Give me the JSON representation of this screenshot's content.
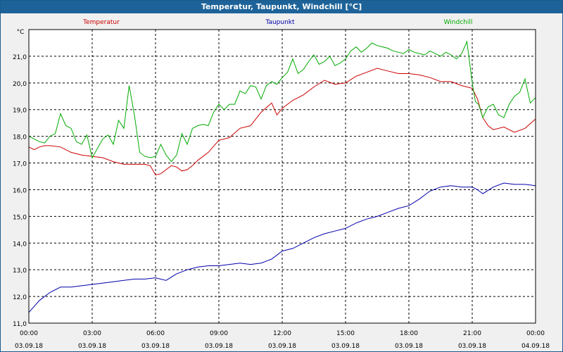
{
  "window": {
    "title": "Temperatur, Taupunkt, Windchill [°C]"
  },
  "chart_data": {
    "type": "line",
    "title": "Temperatur, Taupunkt, Windchill [°C]",
    "ylabel": "°C",
    "ylim": [
      11.0,
      22.0
    ],
    "yticks": [
      "11,0",
      "12,0",
      "13,0",
      "14,0",
      "15,0",
      "16,0",
      "17,0",
      "18,0",
      "19,0",
      "20,0",
      "21,0"
    ],
    "xlim": [
      0,
      24
    ],
    "xticks": [
      {
        "time": "00:00",
        "date": "03.09.18"
      },
      {
        "time": "03:00",
        "date": "03.09.18"
      },
      {
        "time": "06:00",
        "date": "03.09.18"
      },
      {
        "time": "09:00",
        "date": "03.09.18"
      },
      {
        "time": "12:00",
        "date": "03.09.18"
      },
      {
        "time": "15:00",
        "date": "03.09.18"
      },
      {
        "time": "18:00",
        "date": "03.09.18"
      },
      {
        "time": "21:00",
        "date": "03.09.18"
      },
      {
        "time": "00:00",
        "date": "04.09.18"
      }
    ],
    "grid": true,
    "series": [
      {
        "name": "Temperatur",
        "color": "#cc0000",
        "x": [
          0,
          0.25,
          0.5,
          0.75,
          1,
          1.5,
          2,
          2.5,
          3,
          3.5,
          4,
          4.5,
          5,
          5.5,
          5.75,
          6,
          6.25,
          6.5,
          6.75,
          7,
          7.25,
          7.5,
          7.75,
          8,
          8.5,
          9,
          9.5,
          10,
          10.5,
          11,
          11.5,
          11.75,
          12,
          12.5,
          13,
          13.5,
          14,
          14.5,
          15,
          15.5,
          16,
          16.5,
          17,
          17.5,
          18,
          18.5,
          19,
          19.5,
          20,
          20.5,
          21,
          21.25,
          21.5,
          21.75,
          22,
          22.5,
          23,
          23.5,
          24
        ],
        "values": [
          17.6,
          17.5,
          17.6,
          17.65,
          17.65,
          17.6,
          17.4,
          17.3,
          17.25,
          17.2,
          17.05,
          16.95,
          16.95,
          16.95,
          16.9,
          16.55,
          16.6,
          16.75,
          16.9,
          16.85,
          16.7,
          16.75,
          16.9,
          17.1,
          17.4,
          17.85,
          17.95,
          18.3,
          18.4,
          18.9,
          19.25,
          18.8,
          19.05,
          19.35,
          19.55,
          19.85,
          20.1,
          19.95,
          20.0,
          20.25,
          20.4,
          20.55,
          20.45,
          20.35,
          20.35,
          20.3,
          20.2,
          20.05,
          20.05,
          19.9,
          19.8,
          19.4,
          18.7,
          18.4,
          18.25,
          18.35,
          18.15,
          18.3,
          18.65
        ]
      },
      {
        "name": "Taupunkt",
        "color": "#0000aa",
        "x": [
          0,
          0.5,
          1,
          1.5,
          2,
          2.5,
          3,
          3.5,
          4,
          4.5,
          5,
          5.5,
          6,
          6.5,
          7,
          7.5,
          8,
          8.5,
          9,
          9.5,
          10,
          10.5,
          11,
          11.5,
          12,
          12.5,
          13,
          13.5,
          14,
          14.5,
          15,
          15.5,
          16,
          16.5,
          17,
          17.5,
          18,
          18.5,
          19,
          19.5,
          20,
          20.5,
          21,
          21.25,
          21.5,
          22,
          22.5,
          23,
          23.5,
          24
        ],
        "values": [
          11.4,
          11.85,
          12.15,
          12.35,
          12.35,
          12.4,
          12.45,
          12.5,
          12.55,
          12.6,
          12.65,
          12.65,
          12.7,
          12.6,
          12.85,
          13.0,
          13.1,
          13.15,
          13.15,
          13.2,
          13.25,
          13.2,
          13.25,
          13.4,
          13.7,
          13.8,
          14.0,
          14.2,
          14.35,
          14.45,
          14.55,
          14.75,
          14.9,
          15.0,
          15.15,
          15.3,
          15.4,
          15.65,
          15.95,
          16.1,
          16.15,
          16.1,
          16.1,
          16.0,
          15.85,
          16.1,
          16.25,
          16.2,
          16.2,
          16.15
        ]
      },
      {
        "name": "Windchill",
        "color": "#00aa00",
        "x": [
          0,
          0.5,
          0.75,
          1,
          1.25,
          1.5,
          1.75,
          2,
          2.25,
          2.5,
          2.75,
          3,
          3.25,
          3.5,
          3.75,
          4,
          4.25,
          4.5,
          4.75,
          5,
          5.25,
          5.5,
          5.75,
          6,
          6.25,
          6.5,
          6.75,
          7,
          7.25,
          7.5,
          7.75,
          8,
          8.25,
          8.5,
          8.75,
          9,
          9.25,
          9.5,
          9.75,
          10,
          10.25,
          10.5,
          10.75,
          11,
          11.25,
          11.5,
          11.75,
          12,
          12.25,
          12.5,
          12.75,
          13,
          13.25,
          13.5,
          13.75,
          14,
          14.25,
          14.5,
          14.75,
          15,
          15.25,
          15.5,
          15.75,
          16,
          16.25,
          16.5,
          16.75,
          17,
          17.25,
          17.5,
          17.75,
          18,
          18.25,
          18.5,
          18.75,
          19,
          19.25,
          19.5,
          19.75,
          20,
          20.25,
          20.5,
          20.75,
          21,
          21.15,
          21.3,
          21.5,
          21.75,
          22,
          22.25,
          22.5,
          22.75,
          23,
          23.25,
          23.5,
          23.75,
          24
        ],
        "values": [
          18.0,
          17.8,
          17.75,
          18.0,
          18.1,
          18.85,
          18.4,
          18.3,
          17.8,
          17.7,
          18.05,
          17.2,
          17.55,
          17.9,
          18.05,
          17.7,
          18.6,
          18.3,
          19.9,
          18.8,
          17.4,
          17.25,
          17.2,
          17.25,
          17.7,
          17.3,
          17.05,
          17.3,
          18.1,
          17.7,
          18.3,
          18.4,
          18.45,
          18.4,
          18.9,
          19.2,
          19.0,
          19.2,
          19.2,
          19.7,
          19.6,
          19.9,
          19.85,
          19.4,
          19.9,
          20.05,
          19.95,
          20.2,
          20.4,
          20.9,
          20.35,
          20.5,
          20.8,
          21.05,
          20.7,
          20.8,
          21.0,
          20.65,
          20.75,
          20.9,
          21.2,
          21.35,
          21.15,
          21.3,
          21.5,
          21.4,
          21.35,
          21.3,
          21.2,
          21.15,
          21.1,
          21.25,
          21.15,
          21.1,
          21.05,
          21.2,
          21.1,
          21.0,
          21.15,
          21.05,
          20.9,
          21.1,
          21.55,
          20.0,
          19.3,
          19.2,
          18.7,
          19.1,
          19.2,
          18.8,
          18.7,
          19.2,
          19.5,
          19.65,
          20.15,
          19.25,
          19.45
        ]
      }
    ]
  }
}
